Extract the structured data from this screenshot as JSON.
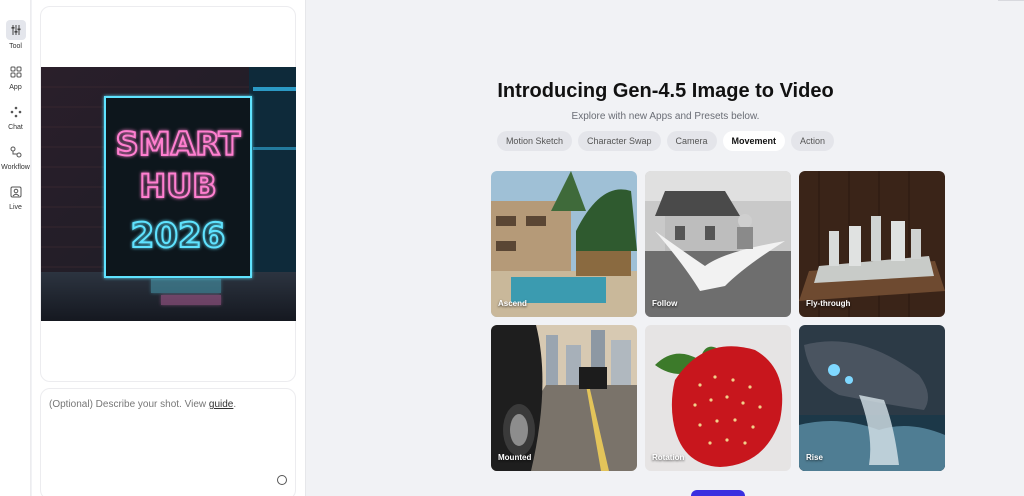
{
  "nav": {
    "items": [
      {
        "label": "Tool",
        "icon": "sliders-icon",
        "active": true
      },
      {
        "label": "App",
        "icon": "grid-icon",
        "active": false
      },
      {
        "label": "Chat",
        "icon": "sparkle-icon",
        "active": false
      },
      {
        "label": "Workflow",
        "icon": "workflow-icon",
        "active": false
      },
      {
        "label": "Live",
        "icon": "live-icon",
        "active": false
      }
    ]
  },
  "panel": {
    "image_text": [
      "SMART",
      "HUB",
      "2026"
    ],
    "prompt_placeholder": "(Optional) Describe your shot. View ",
    "prompt_link": "guide",
    "prompt_suffix": "."
  },
  "main": {
    "headline": "Introducing Gen-4.5 Image to Video",
    "subhead": "Explore with new Apps and Presets below.",
    "tabs": [
      {
        "label": "Motion Sketch",
        "active": false
      },
      {
        "label": "Character Swap",
        "active": false
      },
      {
        "label": "Camera",
        "active": false
      },
      {
        "label": "Movement",
        "active": true
      },
      {
        "label": "Action",
        "active": false
      }
    ],
    "presets": [
      {
        "label": "Ascend"
      },
      {
        "label": "Follow"
      },
      {
        "label": "Fly-through"
      },
      {
        "label": "Mounted"
      },
      {
        "label": "Rotation"
      },
      {
        "label": "Rise"
      }
    ]
  },
  "colors": {
    "accent": "#3a2fe0",
    "neon_pink": "#ff7fd0",
    "neon_cyan": "#5fe3ff"
  }
}
